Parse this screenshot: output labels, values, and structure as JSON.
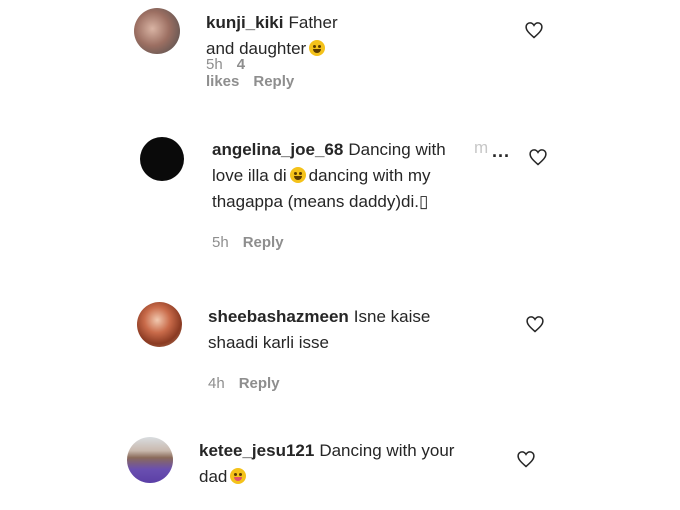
{
  "comments": [
    {
      "username": "kunji_kiki",
      "text": "Father and daughter",
      "emoji": "grinning-sweat-emoji",
      "time": "5h",
      "likes": "4 likes",
      "reply": "Reply"
    },
    {
      "username": "angelina_joe_68",
      "line1": "Dancing with",
      "line1_fade": "m",
      "line2a": "love illa di",
      "line2b": "dancing with my",
      "line3": "thagappa (means daddy)di.▯",
      "emoji": "grinning-sweat-emoji",
      "more": "...",
      "time": "5h",
      "reply": "Reply"
    },
    {
      "username": "sheebashazmeen",
      "line1": "Isne kaise",
      "line2": "shaadi karli isse",
      "time": "4h",
      "reply": "Reply"
    },
    {
      "username": "ketee_jesu121",
      "line1": "Dancing with your",
      "line2": "dad",
      "emoji": "tongue-out-emoji"
    }
  ],
  "colors": {
    "text": "#262626",
    "meta": "#8e8e8e",
    "emoji": "#f4c21a"
  }
}
